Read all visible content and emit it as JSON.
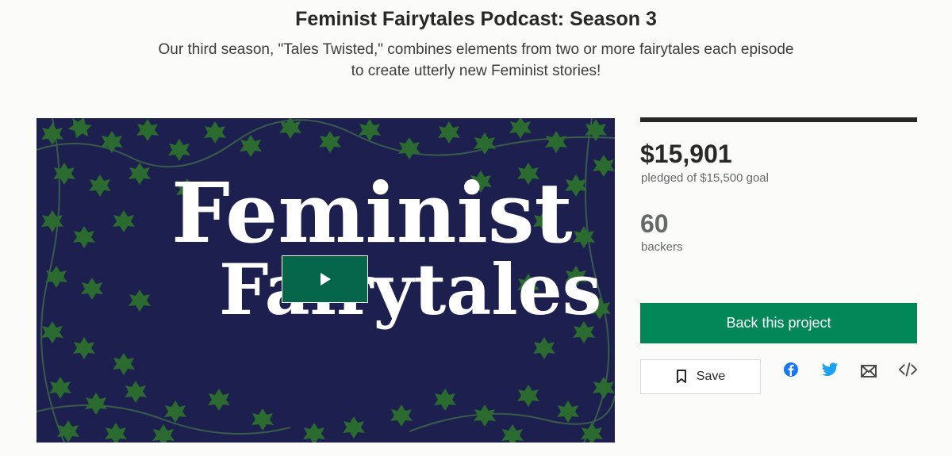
{
  "header": {
    "title": "Feminist Fairytales Podcast: Season 3",
    "subtitle_line1": "Our third season, \"Tales Twisted,\" combines elements from two or more fairytales each episode",
    "subtitle_line2": "to create utterly new Feminist stories!"
  },
  "video": {
    "logo_line1": "Feminist",
    "logo_line2": "Fairytales",
    "play_icon": "play-icon",
    "background_color": "#1d1f4f",
    "leaf_color": "#2c6b2f"
  },
  "stats": {
    "funding_progress": 1.0,
    "pledged": "$15,901",
    "pledged_caption": "pledged of $15,500 goal",
    "backers": "60",
    "backers_caption": "backers"
  },
  "actions": {
    "back_label": "Back this project",
    "save_label": "Save",
    "save_icon": "bookmark-icon",
    "share_icons": [
      "facebook-icon",
      "twitter-icon",
      "email-icon",
      "embed-icon"
    ]
  },
  "colors": {
    "accent_green": "#028858",
    "play_green": "#05664a",
    "facebook": "#1877f2",
    "twitter": "#1da1f2",
    "text_dark": "#282828",
    "text_muted": "#656969"
  }
}
